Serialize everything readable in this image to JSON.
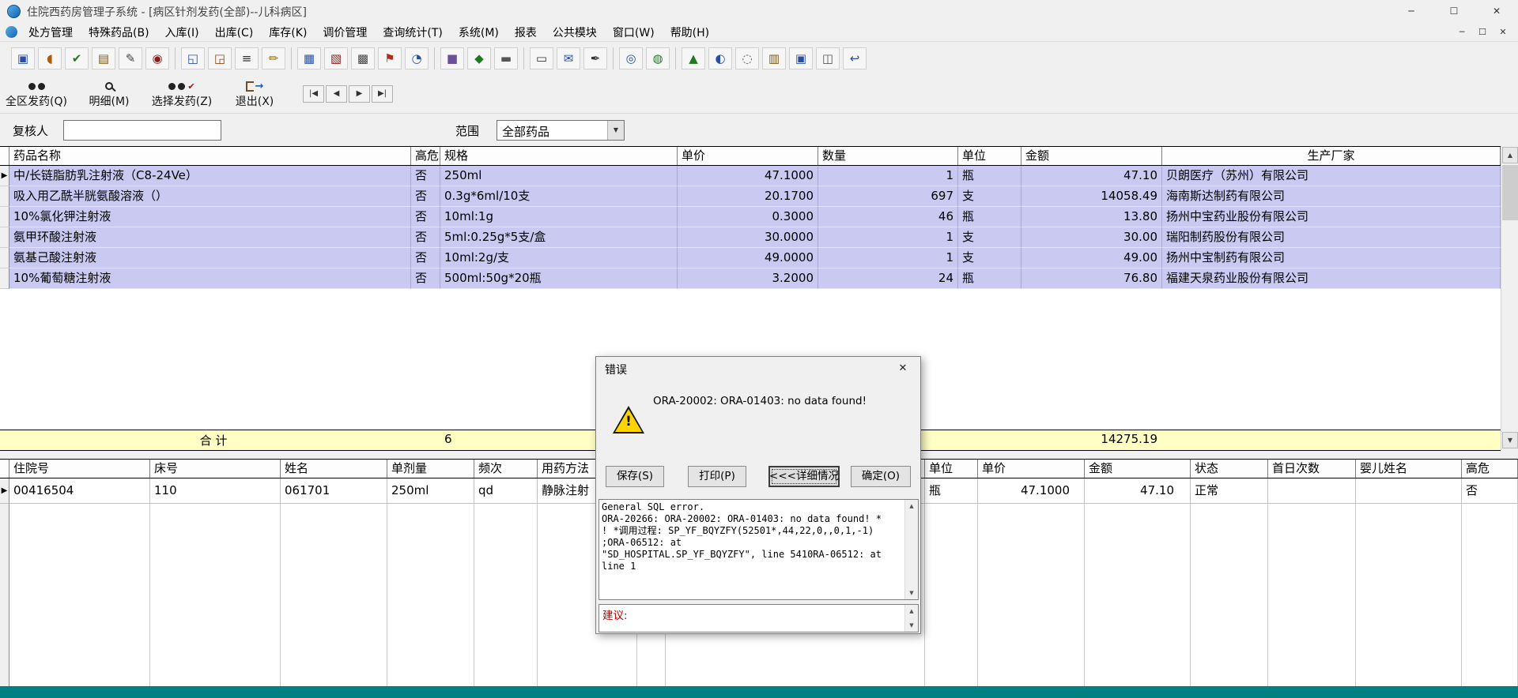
{
  "window": {
    "title": "住院西药房管理子系统 - [病区针剂发药(全部)--儿科病区]",
    "controls": {
      "minimize": "─",
      "maximize": "☐",
      "close": "✕"
    }
  },
  "menu": {
    "items": [
      "处方管理",
      "特殊药品(B)",
      "入库(I)",
      "出库(C)",
      "库存(K)",
      "调价管理",
      "查询统计(T)",
      "系统(M)",
      "报表",
      "公共模块",
      "窗口(W)",
      "帮助(H)"
    ]
  },
  "toolbar": {
    "icons": [
      {
        "name": "monitor-icon",
        "glyph": "▣",
        "color": "#2b4fa0"
      },
      {
        "name": "capsule-icon",
        "glyph": "◖",
        "color": "#b05a10"
      },
      {
        "name": "approve-icon",
        "glyph": "✔",
        "color": "#1d7a1d"
      },
      {
        "name": "ledger-icon",
        "glyph": "▤",
        "color": "#7a5a20"
      },
      {
        "name": "edit-doc-icon",
        "glyph": "✎",
        "color": "#444444"
      },
      {
        "name": "stamp-icon",
        "glyph": "◉",
        "color": "#8b1a1a"
      },
      {
        "sep": true
      },
      {
        "name": "inbox-icon",
        "glyph": "◱",
        "color": "#2b4fa0"
      },
      {
        "name": "outbox-icon",
        "glyph": "◲",
        "color": "#8b4513"
      },
      {
        "name": "list-icon",
        "glyph": "≡",
        "color": "#333333"
      },
      {
        "name": "pencil-icon",
        "glyph": "✏",
        "color": "#a07010"
      },
      {
        "sep": true
      },
      {
        "name": "table-icon",
        "glyph": "▦",
        "color": "#2b4fa0"
      },
      {
        "name": "calendar-icon",
        "glyph": "▧",
        "color": "#8b1a1a"
      },
      {
        "name": "grid-icon",
        "glyph": "▩",
        "color": "#444444"
      },
      {
        "name": "flag-icon",
        "glyph": "⚑",
        "color": "#b03020"
      },
      {
        "name": "clock-icon",
        "glyph": "◔",
        "color": "#2b4fa0"
      },
      {
        "sep": true
      },
      {
        "name": "box-icon",
        "glyph": "■",
        "color": "#6a4f9a"
      },
      {
        "name": "tag-icon",
        "glyph": "◆",
        "color": "#1d7a1d"
      },
      {
        "name": "truck-icon",
        "glyph": "▬",
        "color": "#555555"
      },
      {
        "sep": true
      },
      {
        "name": "printer-icon",
        "glyph": "▭",
        "color": "#333333"
      },
      {
        "name": "mail-icon",
        "glyph": "✉",
        "color": "#2b4fa0"
      },
      {
        "name": "pen-icon",
        "glyph": "✒",
        "color": "#333333"
      },
      {
        "sep": true
      },
      {
        "name": "zoom-icon",
        "glyph": "◎",
        "color": "#2b4fa0"
      },
      {
        "name": "target-icon",
        "glyph": "◍",
        "color": "#1d7a1d"
      },
      {
        "sep": true
      },
      {
        "name": "chart-icon",
        "glyph": "▲",
        "color": "#1d7a1d"
      },
      {
        "name": "globe-icon",
        "glyph": "◐",
        "color": "#2b4fa0"
      },
      {
        "name": "find-icon",
        "glyph": "◌",
        "color": "#555555"
      },
      {
        "name": "report-icon",
        "glyph": "▥",
        "color": "#7a5a20"
      },
      {
        "name": "copy-icon",
        "glyph": "▣",
        "color": "#2b4fa0"
      },
      {
        "name": "flow-icon",
        "glyph": "◫",
        "color": "#555555"
      },
      {
        "name": "undo-icon",
        "glyph": "↩",
        "color": "#2b4fa0"
      }
    ]
  },
  "actions": {
    "buttons": [
      "全区发药(Q)",
      "明细(M)",
      "选择发药(Z)",
      "退出(X)"
    ],
    "nav": [
      "|◀",
      "◀",
      "▶",
      "▶|"
    ]
  },
  "form": {
    "reviewer_label": "复核人",
    "reviewer_value": "",
    "scope_label": "范围",
    "scope_value": "全部药品"
  },
  "ui": {
    "up": "▲",
    "down": "▼",
    "marker": "▶"
  },
  "main_table": {
    "columns": [
      "药品名称",
      "高危",
      "规格",
      "单价",
      "数量",
      "单位",
      "金额",
      "生产厂家"
    ],
    "rows": [
      [
        "中/长链脂肪乳注射液（C8-24Ve）",
        "否",
        "250ml",
        "47.1000",
        "1",
        "瓶",
        "47.10",
        "贝朗医疗（苏州）有限公司"
      ],
      [
        "吸入用乙酰半胱氨酸溶液（）",
        "否",
        "0.3g*6ml/10支",
        "20.1700",
        "697",
        "支",
        "14058.49",
        "海南斯达制药有限公司"
      ],
      [
        "10%氯化钾注射液",
        "否",
        "10ml:1g",
        "0.3000",
        "46",
        "瓶",
        "13.80",
        "扬州中宝药业股份有限公司"
      ],
      [
        "氨甲环酸注射液",
        "否",
        "5ml:0.25g*5支/盒",
        "30.0000",
        "1",
        "支",
        "30.00",
        "瑞阳制药股份有限公司"
      ],
      [
        "氨基己酸注射液",
        "否",
        "10ml:2g/支",
        "49.0000",
        "1",
        "支",
        "49.00",
        "扬州中宝制药有限公司"
      ],
      [
        "10%葡萄糖注射液",
        "否",
        "500ml:50g*20瓶",
        "3.2000",
        "24",
        "瓶",
        "76.80",
        "福建天泉药业股份有限公司"
      ]
    ],
    "summary": {
      "label": "合  计",
      "count": "6",
      "total": "14275.19"
    }
  },
  "bottom_table": {
    "columns": [
      "住院号",
      "床号",
      "姓名",
      "单剂量",
      "频次",
      "用药方法",
      "单位",
      "单价",
      "金额",
      "状态",
      "首日次数",
      "婴儿姓名",
      "高危"
    ],
    "row": [
      "00416504",
      "110",
      "061701",
      "250ml",
      "qd",
      "静脉注射",
      "瓶",
      "47.1000",
      "47.10",
      "正常",
      "",
      "",
      "否"
    ]
  },
  "dialog": {
    "title": "错误",
    "message": "ORA-20002: ORA-01403: no data found!",
    "buttons": [
      "保存(S)",
      "打印(P)",
      "<<<详细情况",
      "确定(O)"
    ],
    "detail_text": "General SQL error.\nORA-20266: ORA-20002: ORA-01403: no data found! *\n! *调用过程: SP_YF_BQYZFY(52501*,44,22,0,,0,1,-1)\n;ORA-06512: at\n\"SD_HOSPITAL.SP_YF_BQYZFY\", line 5410RA-06512: at\nline 1",
    "suggestion_label": "建议:"
  }
}
